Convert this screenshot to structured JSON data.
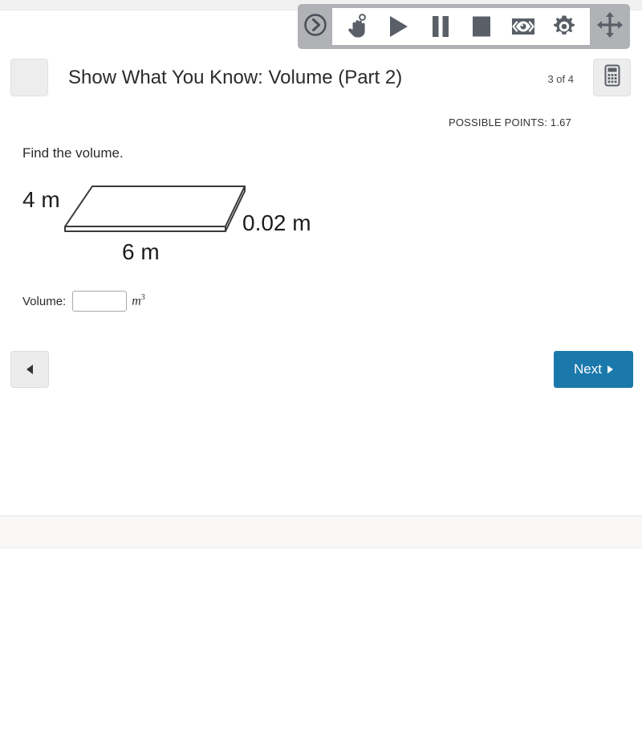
{
  "media_toolbar": {
    "handle_icon": "chevron-right-circle-icon",
    "move_icon": "move-arrows-icon",
    "buttons": [
      {
        "name": "tap-hand-icon",
        "label": "Tap"
      },
      {
        "name": "play-icon",
        "label": "Play"
      },
      {
        "name": "pause-icon",
        "label": "Pause"
      },
      {
        "name": "stop-icon",
        "label": "Stop"
      },
      {
        "name": "eye-caption-icon",
        "label": "Captions"
      },
      {
        "name": "gear-icon",
        "label": "Settings"
      }
    ]
  },
  "header": {
    "menu_icon": "hamburger-menu-icon",
    "title": "Show What You Know: Volume (Part 2)",
    "page_counter": "3 of 4",
    "calculator_icon": "calculator-icon"
  },
  "meta": {
    "possible_points": "POSSIBLE POINTS: 1.67"
  },
  "question": {
    "prompt": "Find the volume.",
    "figure": {
      "type": "rectangular-prism-slab",
      "labels": {
        "depth": "4 m",
        "width": "6 m",
        "height": "0.02 m"
      }
    },
    "answer": {
      "label": "Volume:",
      "value": "",
      "placeholder": "",
      "unit": "m",
      "unit_exponent": "3"
    }
  },
  "navigation": {
    "prev_label": "",
    "prev_icon": "triangle-left-icon",
    "next_label": "Next",
    "next_icon": "triangle-right-icon",
    "next_color": "#1b78ab"
  }
}
